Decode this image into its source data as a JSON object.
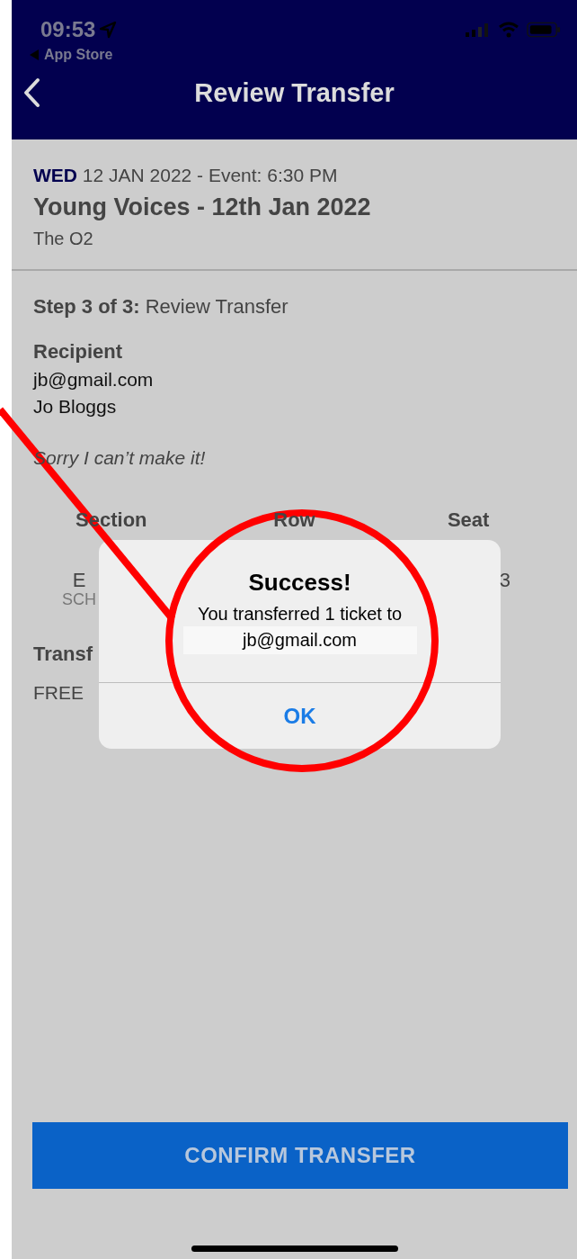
{
  "status_bar": {
    "time": "09:53",
    "back_app": "App Store"
  },
  "nav": {
    "title": "Review Transfer"
  },
  "event": {
    "weekday": "WED",
    "date": "12 JAN 2022 - Event: 6:30 PM",
    "name": "Young Voices - 12th Jan 2022",
    "venue": "The O2"
  },
  "step": {
    "label": "Step 3 of 3:",
    "value": "Review Transfer"
  },
  "recipient": {
    "heading": "Recipient",
    "email": "jb@gmail.com",
    "name": "Jo Bloggs",
    "message": "Sorry I can’t make it!"
  },
  "seat_table": {
    "columns": [
      "Section",
      "Row",
      "Seat"
    ],
    "section_value": "E",
    "section_sub": "SCH",
    "seat_value": "3"
  },
  "transfer_fee": {
    "label": "Transf",
    "value": "FREE"
  },
  "alert": {
    "title": "Success!",
    "message": "You transferred 1 ticket to",
    "recipient": "jb@gmail.com",
    "button": "OK"
  },
  "confirm_button": "CONFIRM TRANSFER"
}
